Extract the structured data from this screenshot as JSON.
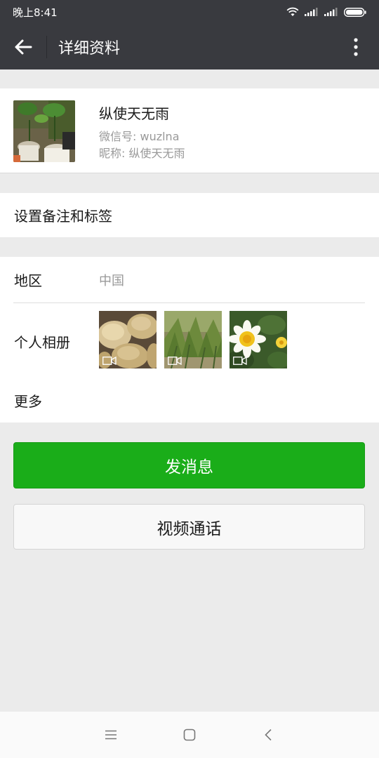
{
  "status_bar": {
    "time": "晚上8:41",
    "icons": [
      "wifi-icon",
      "signal-icon",
      "signal-icon",
      "battery-icon"
    ]
  },
  "header": {
    "title": "详细资料",
    "back_icon": "arrow-left-icon",
    "more_icon": "more-vertical-icon"
  },
  "profile": {
    "name": "纵使天无雨",
    "wechat_id": "微信号: wuzlna",
    "nickname": "昵称: 纵使天无雨"
  },
  "remark": {
    "label": "设置备注和标签"
  },
  "info": {
    "region_label": "地区",
    "region_value": "中国",
    "album_label": "个人相册",
    "more_label": "更多"
  },
  "actions": {
    "send_message": "发消息",
    "video_call": "视频通话"
  },
  "colors": {
    "header_bg": "#393a3f",
    "primary_green": "#1aad19",
    "page_bg": "#ebebeb"
  },
  "nav": {
    "icons": [
      "menu-icon",
      "home-icon",
      "back-icon"
    ]
  }
}
